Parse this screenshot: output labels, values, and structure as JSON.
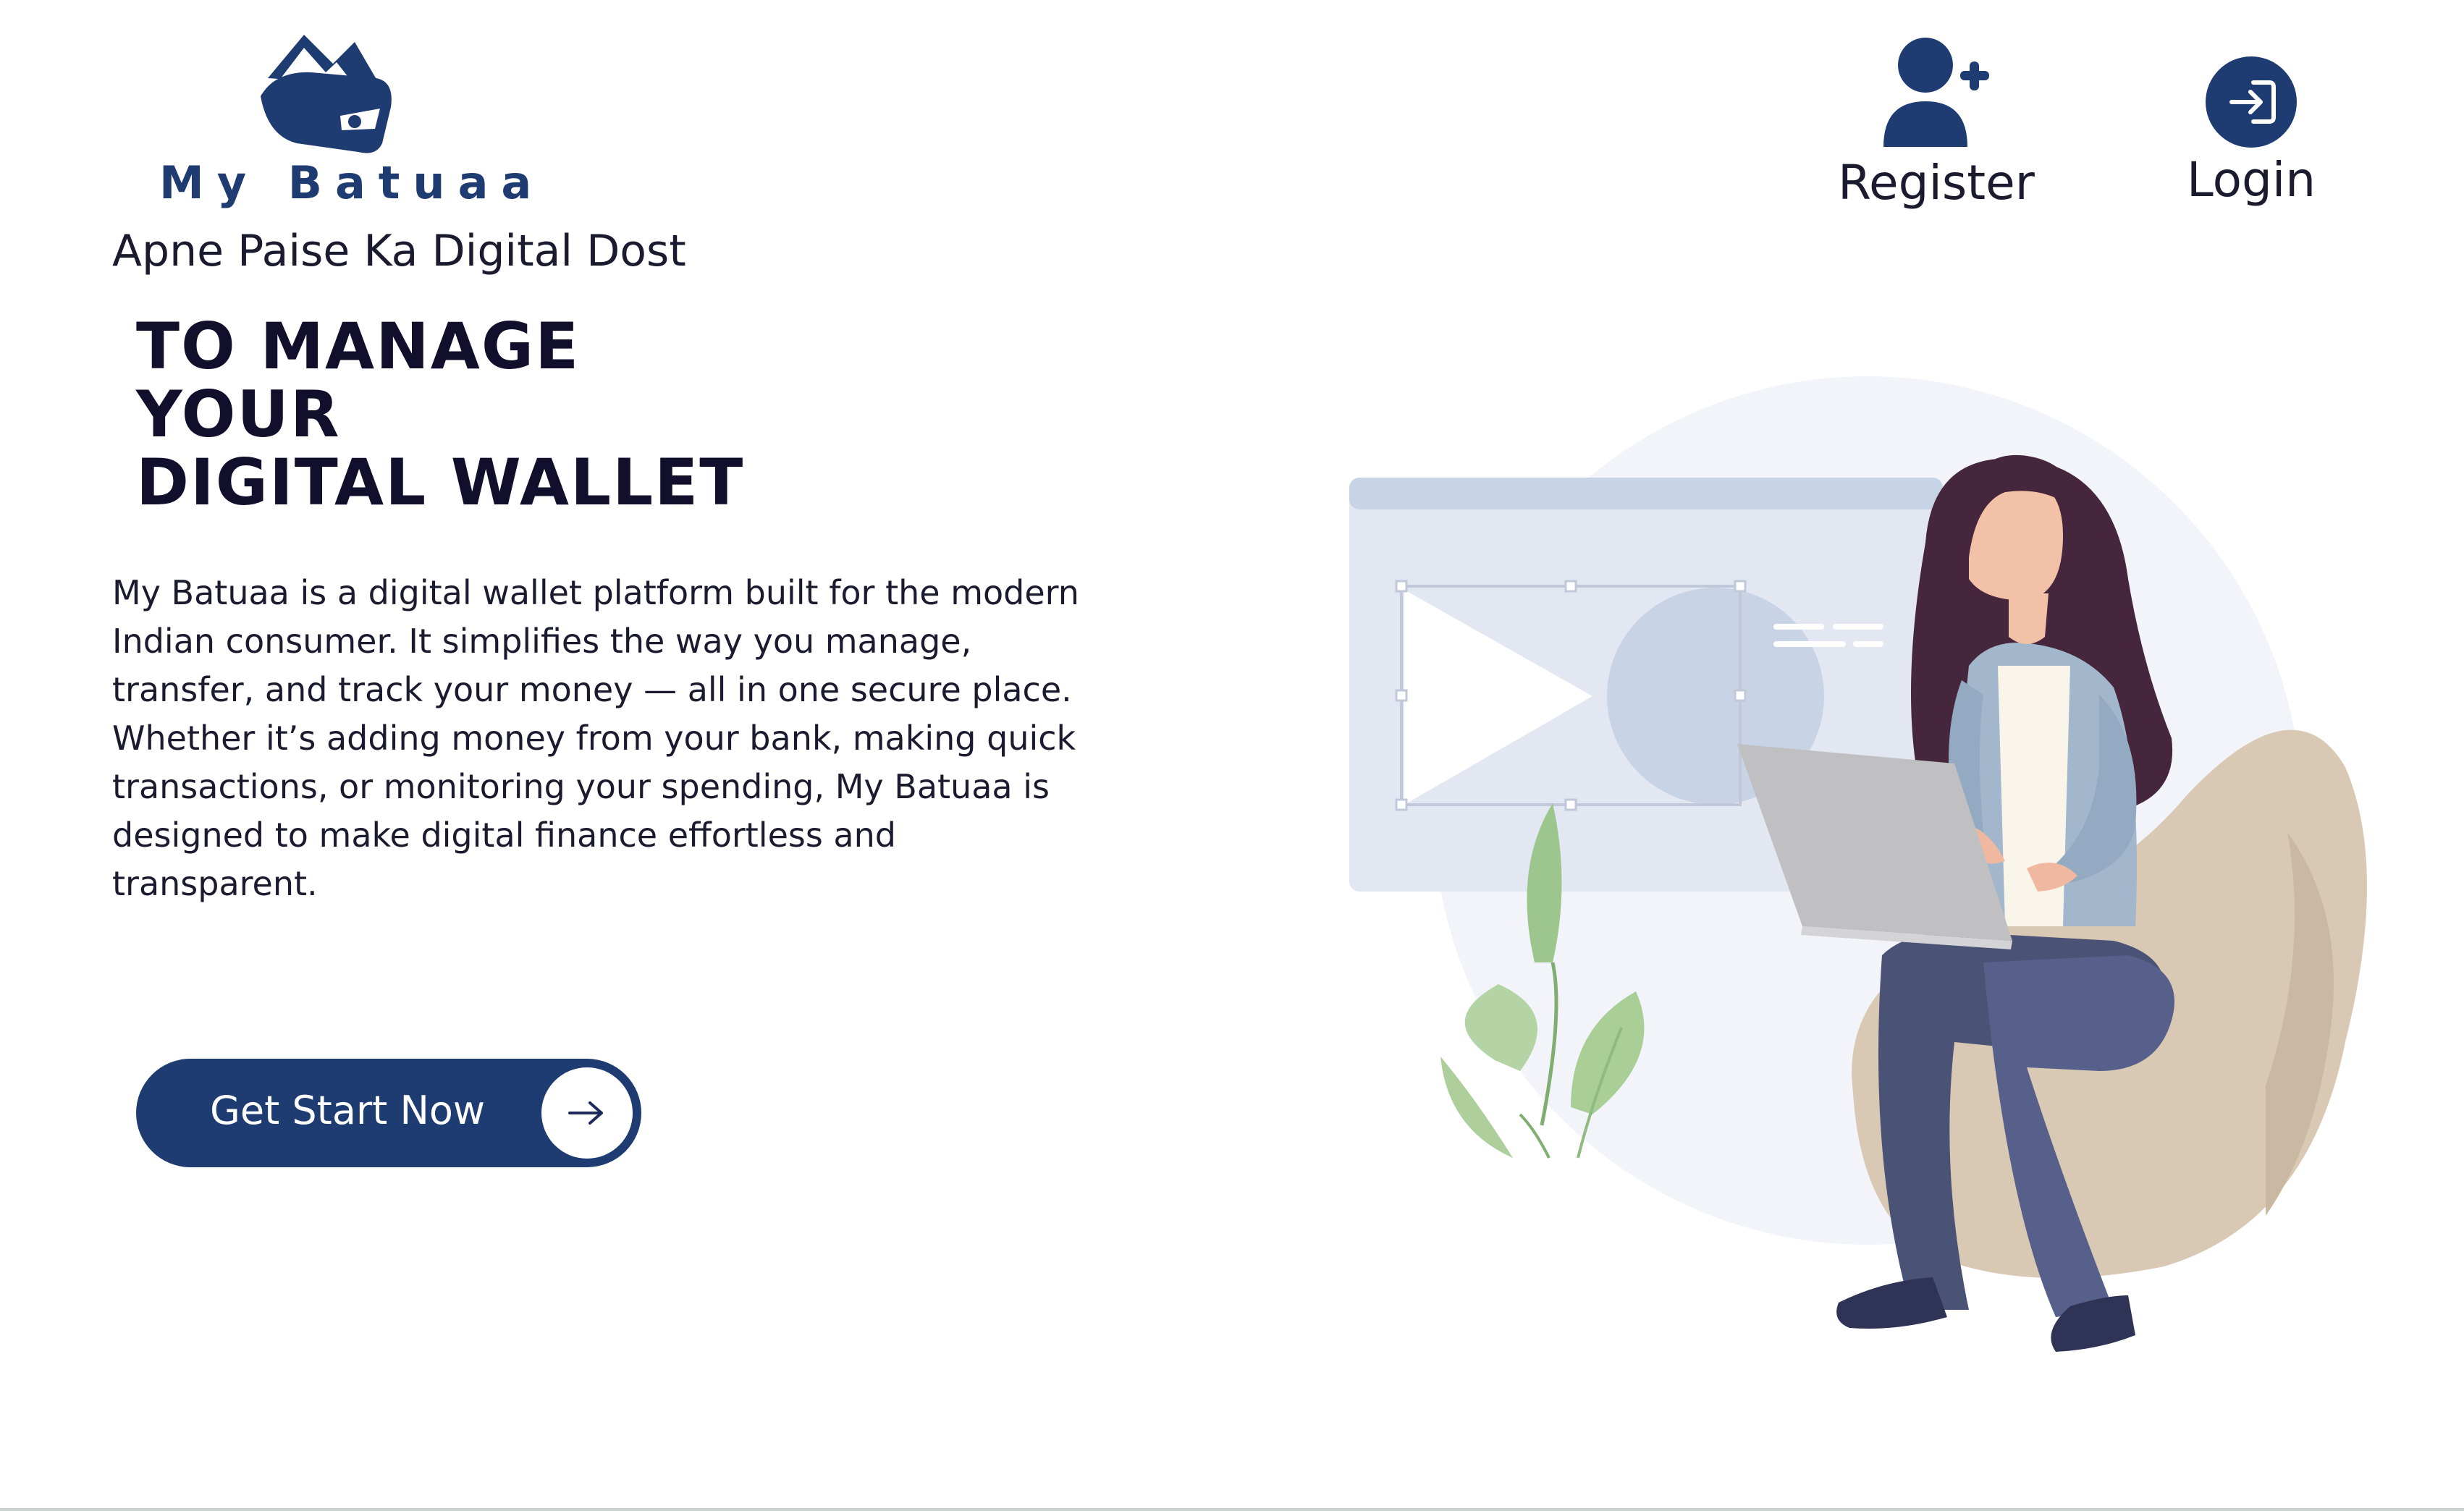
{
  "brand": {
    "logo_text": "My Batuaa",
    "tagline": "Apne Paise Ka Digital Dost"
  },
  "nav": {
    "register_label": "Register",
    "login_label": "Login",
    "register_icon": "user-plus-icon",
    "login_icon": "sign-in-icon"
  },
  "hero": {
    "headline_lines": [
      "TO MANAGE",
      "YOUR",
      "DIGITAL WALLET"
    ],
    "description": "My Batuaa is a digital wallet platform built for the modern Indian consumer. It simplifies the way you manage, transfer, and track your money — all in one secure place. Whether it’s adding money from your bank, making quick transactions, or monitoring your spending, My Batuaa is designed to make digital finance effortless and transparent.",
    "cta_label": "Get Start Now",
    "cta_icon": "arrow-right-icon"
  },
  "colors": {
    "brand_blue": "#1e3c72",
    "headline": "#120f2d",
    "text": "#1b1b2f"
  }
}
